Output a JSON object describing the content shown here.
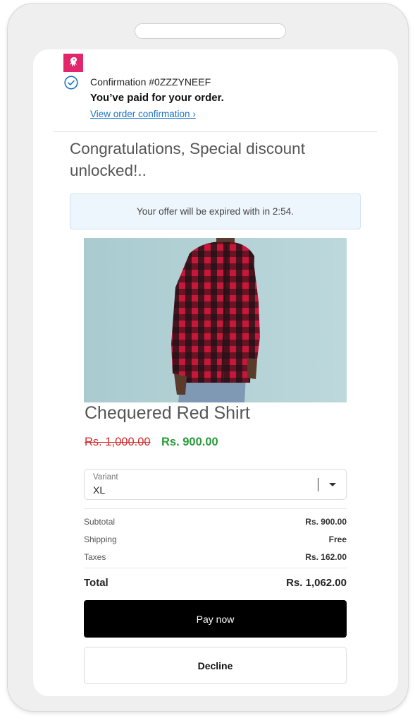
{
  "colors": {
    "brand": "#e3256b",
    "link": "#1a73c9",
    "old_price": "#d32f2f",
    "new_price": "#2a9a3a",
    "timer_bg": "#eef6fd",
    "pay_button_bg": "#000000"
  },
  "header": {
    "logo_icon": "octopus-icon",
    "status_icon": "check-circle-icon",
    "confirmation_number": "Confirmation #0ZZZYNEEF",
    "paid_message": "You’ve paid for your order.",
    "view_link": "View order confirmation ›"
  },
  "offer": {
    "headline": "Congratulations, Special discount unlocked!..",
    "timer_text": "Your offer will be expired with in 2:54."
  },
  "product": {
    "image_icon": "product-photo-red-chequered-shirt",
    "title": "Chequered Red Shirt",
    "original_price": "Rs. 1,000.00",
    "discount_price": "Rs. 900.00",
    "variant": {
      "label": "Variant",
      "selected": "XL"
    }
  },
  "summary": {
    "rows": [
      {
        "label": "Subtotal",
        "value": "Rs. 900.00"
      },
      {
        "label": "Shipping",
        "value": "Free"
      },
      {
        "label": "Taxes",
        "value": "Rs. 162.00"
      }
    ],
    "total_label": "Total",
    "total_value": "Rs. 1,062.00"
  },
  "actions": {
    "pay_label": "Pay now",
    "decline_label": "Decline"
  }
}
